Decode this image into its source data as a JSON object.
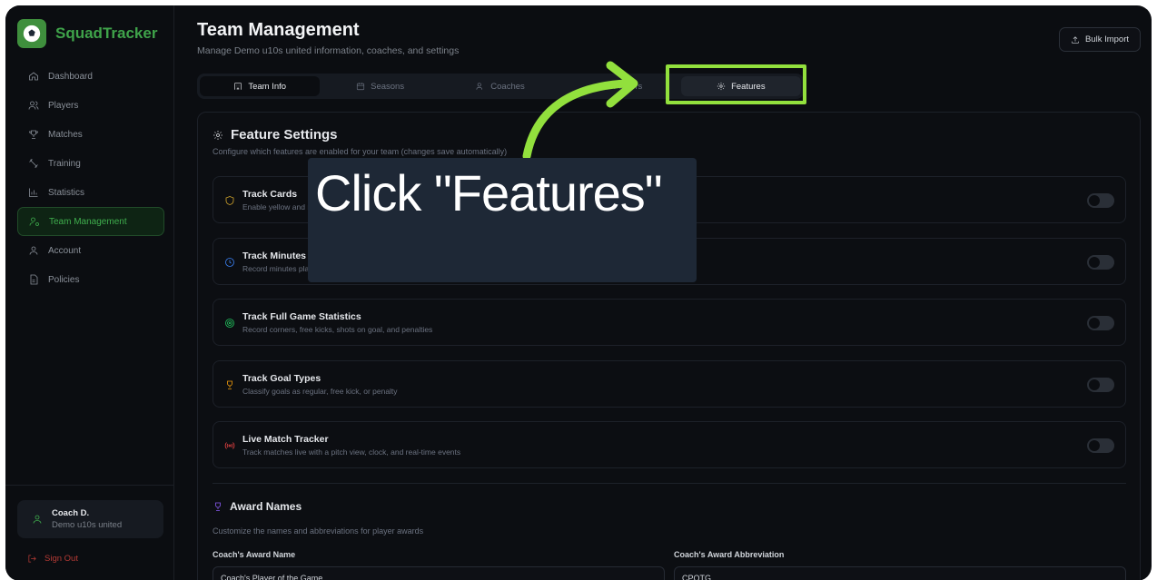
{
  "brand": {
    "name": "SquadTracker"
  },
  "sidebar": {
    "items": [
      {
        "label": "Dashboard",
        "icon": "home-icon"
      },
      {
        "label": "Players",
        "icon": "users-icon"
      },
      {
        "label": "Matches",
        "icon": "trophy-icon"
      },
      {
        "label": "Training",
        "icon": "dumbbell-icon"
      },
      {
        "label": "Statistics",
        "icon": "bar-chart-icon"
      },
      {
        "label": "Team Management",
        "icon": "user-cog-icon",
        "active": true
      },
      {
        "label": "Account",
        "icon": "user-icon"
      },
      {
        "label": "Policies",
        "icon": "file-icon"
      }
    ],
    "user": {
      "name": "Coach D.",
      "team": "Demo u10s united"
    },
    "signout": "Sign Out"
  },
  "header": {
    "title": "Team Management",
    "subtitle": "Manage Demo u10s united information, coaches, and settings",
    "bulk_import": "Bulk Import"
  },
  "tabs": [
    {
      "label": "Team Info"
    },
    {
      "label": "Seasons"
    },
    {
      "label": "Coaches"
    },
    {
      "label": "Players"
    },
    {
      "label": "Features"
    }
  ],
  "features": {
    "title": "Feature Settings",
    "subtitle": "Configure which features are enabled for your team (changes save automatically)",
    "items": [
      {
        "name": "Track Cards",
        "desc": "Enable yellow and red card tracking",
        "color": "#d4a72c"
      },
      {
        "name": "Track Minutes",
        "desc": "Record minutes played for each player",
        "color": "#3b82f6"
      },
      {
        "name": "Track Full Game Statistics",
        "desc": "Record corners, free kicks, shots on goal, and penalties",
        "color": "#22c55e"
      },
      {
        "name": "Track Goal Types",
        "desc": "Classify goals as regular, free kick, or penalty",
        "color": "#f59e0b"
      },
      {
        "name": "Live Match Tracker",
        "desc": "Track matches live with a pitch view, clock, and real-time events",
        "color": "#ef4444"
      }
    ]
  },
  "awards": {
    "title": "Award Names",
    "subtitle": "Customize the names and abbreviations for player awards",
    "name_label": "Coach's Award Name",
    "name_value": "Coach's Player of the Game",
    "abbr_label": "Coach's Award Abbreviation",
    "abbr_value": "CPOTG"
  },
  "overlay": {
    "instruction": "Click \"Features\"",
    "highlight_color": "#92e03d"
  }
}
